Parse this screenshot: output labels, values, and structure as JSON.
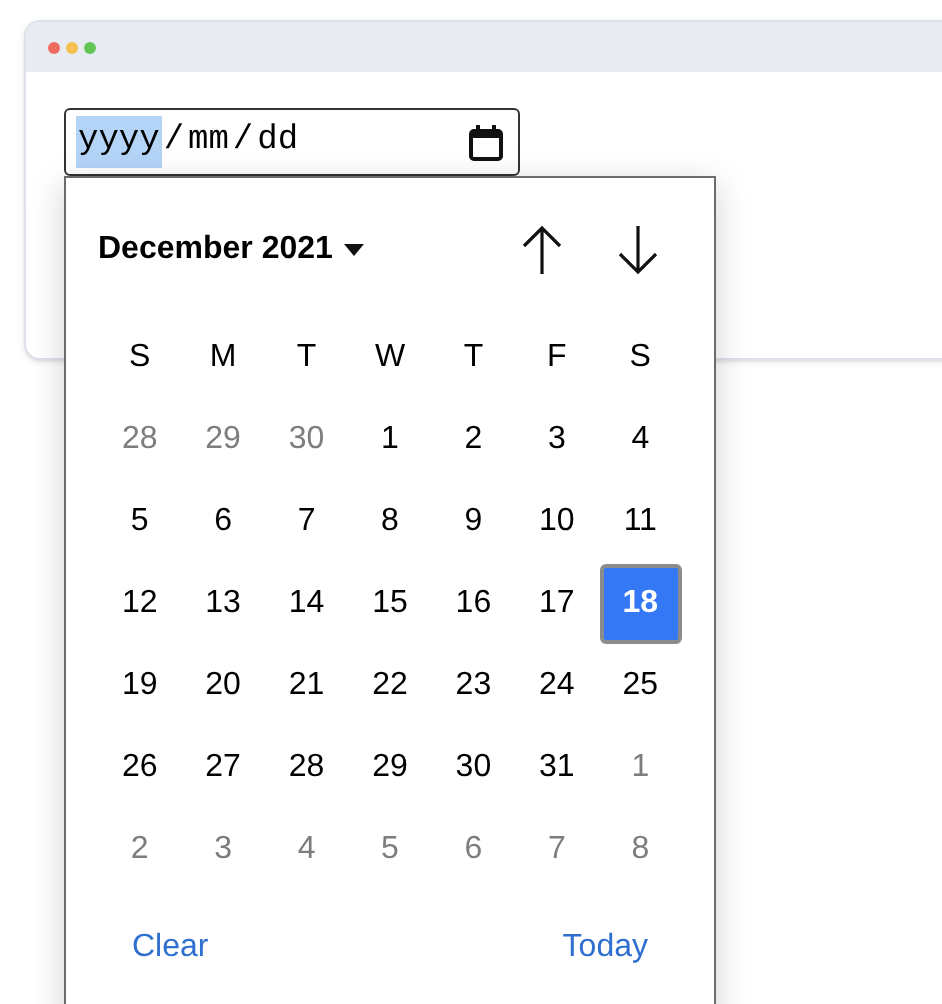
{
  "window": {
    "dots": [
      {
        "color": "#ee6b60"
      },
      {
        "color": "#f5be4f"
      },
      {
        "color": "#62c554"
      }
    ]
  },
  "date_input": {
    "segments": [
      {
        "text": "yyyy",
        "selected": true
      },
      {
        "text": "/",
        "selected": false
      },
      {
        "text": "mm",
        "selected": false
      },
      {
        "text": "/",
        "selected": false
      },
      {
        "text": "dd",
        "selected": false
      }
    ]
  },
  "calendar": {
    "month_label": "December 2021",
    "weekdays": [
      "S",
      "M",
      "T",
      "W",
      "T",
      "F",
      "S"
    ],
    "weeks": [
      [
        {
          "day": "28",
          "outside": true,
          "selected": false
        },
        {
          "day": "29",
          "outside": true,
          "selected": false
        },
        {
          "day": "30",
          "outside": true,
          "selected": false
        },
        {
          "day": "1",
          "outside": false,
          "selected": false
        },
        {
          "day": "2",
          "outside": false,
          "selected": false
        },
        {
          "day": "3",
          "outside": false,
          "selected": false
        },
        {
          "day": "4",
          "outside": false,
          "selected": false
        }
      ],
      [
        {
          "day": "5",
          "outside": false,
          "selected": false
        },
        {
          "day": "6",
          "outside": false,
          "selected": false
        },
        {
          "day": "7",
          "outside": false,
          "selected": false
        },
        {
          "day": "8",
          "outside": false,
          "selected": false
        },
        {
          "day": "9",
          "outside": false,
          "selected": false
        },
        {
          "day": "10",
          "outside": false,
          "selected": false
        },
        {
          "day": "11",
          "outside": false,
          "selected": false
        }
      ],
      [
        {
          "day": "12",
          "outside": false,
          "selected": false
        },
        {
          "day": "13",
          "outside": false,
          "selected": false
        },
        {
          "day": "14",
          "outside": false,
          "selected": false
        },
        {
          "day": "15",
          "outside": false,
          "selected": false
        },
        {
          "day": "16",
          "outside": false,
          "selected": false
        },
        {
          "day": "17",
          "outside": false,
          "selected": false
        },
        {
          "day": "18",
          "outside": false,
          "selected": true
        }
      ],
      [
        {
          "day": "19",
          "outside": false,
          "selected": false
        },
        {
          "day": "20",
          "outside": false,
          "selected": false
        },
        {
          "day": "21",
          "outside": false,
          "selected": false
        },
        {
          "day": "22",
          "outside": false,
          "selected": false
        },
        {
          "day": "23",
          "outside": false,
          "selected": false
        },
        {
          "day": "24",
          "outside": false,
          "selected": false
        },
        {
          "day": "25",
          "outside": false,
          "selected": false
        }
      ],
      [
        {
          "day": "26",
          "outside": false,
          "selected": false
        },
        {
          "day": "27",
          "outside": false,
          "selected": false
        },
        {
          "day": "28",
          "outside": false,
          "selected": false
        },
        {
          "day": "29",
          "outside": false,
          "selected": false
        },
        {
          "day": "30",
          "outside": false,
          "selected": false
        },
        {
          "day": "31",
          "outside": false,
          "selected": false
        },
        {
          "day": "1",
          "outside": true,
          "selected": false
        }
      ],
      [
        {
          "day": "2",
          "outside": true,
          "selected": false
        },
        {
          "day": "3",
          "outside": true,
          "selected": false
        },
        {
          "day": "4",
          "outside": true,
          "selected": false
        },
        {
          "day": "5",
          "outside": true,
          "selected": false
        },
        {
          "day": "6",
          "outside": true,
          "selected": false
        },
        {
          "day": "7",
          "outside": true,
          "selected": false
        },
        {
          "day": "8",
          "outside": true,
          "selected": false
        }
      ]
    ],
    "footer": {
      "clear": "Clear",
      "today": "Today"
    }
  }
}
